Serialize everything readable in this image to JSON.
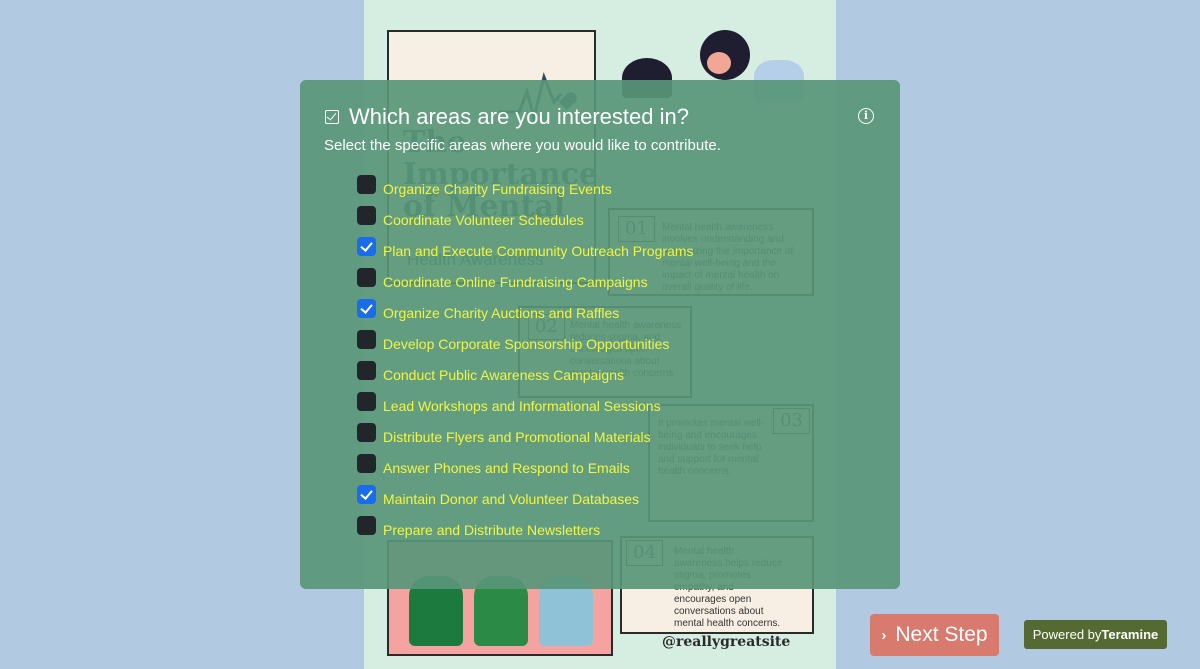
{
  "poster": {
    "title": "The Importance of Mental",
    "subtitle": "Health Awareness",
    "cards": [
      {
        "num": "01",
        "text": "Mental health awareness involves understanding and recognizing the importance of mental well-being and the impact of mental health on overall quality of life."
      },
      {
        "num": "02",
        "text": "Mental health awareness reduces stigma, and encourages open conversations about mental health concerns."
      },
      {
        "num": "03",
        "text": "It promotes mental well-being and encourages individuals to seek help and support for mental health concerns."
      },
      {
        "num": "04",
        "text": "Mental health awareness helps reduce stigma, promotes empathy, and encourages open conversations about mental health concerns."
      }
    ],
    "site": "@reallygreatsite"
  },
  "question": {
    "title": "Which areas are you interested in?",
    "description": "Select the specific areas where you would like to contribute.",
    "info_icon": "info-icon",
    "options": [
      {
        "label": "Organize Charity Fundraising Events",
        "checked": false
      },
      {
        "label": "Coordinate Volunteer Schedules",
        "checked": false
      },
      {
        "label": "Plan and Execute Community Outreach Programs",
        "checked": true
      },
      {
        "label": "Coordinate Online Fundraising Campaigns",
        "checked": false
      },
      {
        "label": "Organize Charity Auctions and Raffles",
        "checked": true
      },
      {
        "label": "Develop Corporate Sponsorship Opportunities",
        "checked": false
      },
      {
        "label": "Conduct Public Awareness Campaigns",
        "checked": false
      },
      {
        "label": "Lead Workshops and Informational Sessions",
        "checked": false
      },
      {
        "label": "Distribute Flyers and Promotional Materials",
        "checked": false
      },
      {
        "label": "Answer Phones and Respond to Emails",
        "checked": false
      },
      {
        "label": "Maintain Donor and Volunteer Databases",
        "checked": true
      },
      {
        "label": "Prepare and Distribute Newsletters",
        "checked": false
      }
    ]
  },
  "footer": {
    "next_label": "Next Step",
    "powered_prefix": "Powered by",
    "powered_brand": "Teramine"
  },
  "colors": {
    "overlay": "#589678",
    "option_text": "#f2f542",
    "checkbox_checked": "#1a6dea",
    "checkbox_unchecked": "#22262b",
    "next_button": "#d87a6d",
    "powered_badge": "#556a32",
    "page_background": "#b1cae2"
  }
}
